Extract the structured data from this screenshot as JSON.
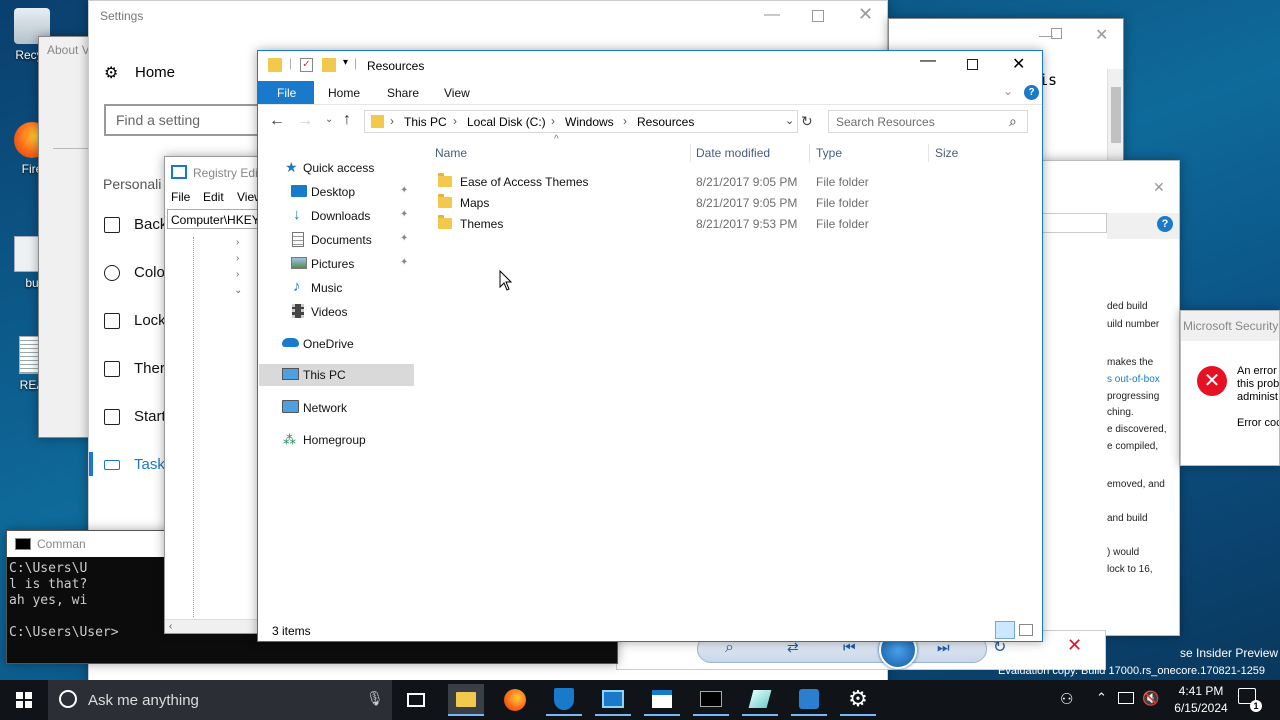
{
  "desktop": {
    "icons": [
      {
        "label": "Recyc",
        "icon": "recycle-bin-icon"
      },
      {
        "label": "Fire",
        "icon": "firefox-icon"
      },
      {
        "label": "bu",
        "icon": "file-icon"
      },
      {
        "label": "REA",
        "icon": "document-icon"
      }
    ]
  },
  "about_window": {
    "title": "About V"
  },
  "settings": {
    "title": "Settings",
    "home": "Home",
    "search_placeholder": "Find a setting",
    "section": "Personali",
    "items": [
      "Back",
      "Colo",
      "Lock",
      "Ther",
      "Start",
      "Task"
    ]
  },
  "regedit": {
    "title": "Registry Edit",
    "menu": [
      "File",
      "Edit",
      "View"
    ],
    "address": "Computer\\HKEY"
  },
  "cmd": {
    "title": "Comman",
    "lines": [
      "C:\\Users\\U",
      "l is that?",
      "ah yes, wi",
      "",
      "C:\\Users\\User>"
    ]
  },
  "background_text": {
    "top_text": "is",
    "notes": [
      "ded build",
      "uild number",
      "makes the",
      "s out-of-box",
      "progressing",
      "ching.",
      "e discovered,",
      "e compiled,",
      "emoved, and",
      "and build",
      ") would",
      "lock to 16,"
    ]
  },
  "security": {
    "title": "Microsoft Security",
    "message": [
      "An error",
      "this prob",
      "administ"
    ],
    "code": "Error coc"
  },
  "watermark": {
    "line1": "se Insider Preview",
    "line2": "Evaluation copy. Build 17000.rs_onecore.170821-1259"
  },
  "explorer": {
    "title": "Resources",
    "ribbon_tabs": [
      "File",
      "Home",
      "Share",
      "View"
    ],
    "breadcrumb": [
      "This PC",
      "Local Disk (C:)",
      "Windows",
      "Resources"
    ],
    "search_placeholder": "Search Resources",
    "columns": [
      "Name",
      "Date modified",
      "Type",
      "Size"
    ],
    "nav": [
      {
        "label": "Quick access",
        "icon": "star-icon",
        "pinned": false
      },
      {
        "label": "Desktop",
        "icon": "desktop-icon",
        "pinned": true
      },
      {
        "label": "Downloads",
        "icon": "downloads-icon",
        "pinned": true
      },
      {
        "label": "Documents",
        "icon": "documents-icon",
        "pinned": true
      },
      {
        "label": "Pictures",
        "icon": "pictures-icon",
        "pinned": true
      },
      {
        "label": "Music",
        "icon": "music-icon",
        "pinned": false
      },
      {
        "label": "Videos",
        "icon": "videos-icon",
        "pinned": false
      },
      {
        "label": "OneDrive",
        "icon": "cloud-icon",
        "pinned": false
      },
      {
        "label": "This PC",
        "icon": "computer-icon",
        "pinned": false
      },
      {
        "label": "Network",
        "icon": "network-icon",
        "pinned": false
      },
      {
        "label": "Homegroup",
        "icon": "homegroup-icon",
        "pinned": false
      }
    ],
    "files": [
      {
        "name": "Ease of Access Themes",
        "date": "8/21/2017 9:05 PM",
        "type": "File folder",
        "size": ""
      },
      {
        "name": "Maps",
        "date": "8/21/2017 9:05 PM",
        "type": "File folder",
        "size": ""
      },
      {
        "name": "Themes",
        "date": "8/21/2017 9:53 PM",
        "type": "File folder",
        "size": ""
      }
    ],
    "status": "3 items"
  },
  "taskbar": {
    "search_placeholder": "Ask me anything",
    "time": "4:41 PM",
    "date": "6/15/2024"
  },
  "colors": {
    "accent": "#1979ca",
    "selected": "#cce8ff",
    "error": "#e81123",
    "taskbar": "#101418"
  }
}
